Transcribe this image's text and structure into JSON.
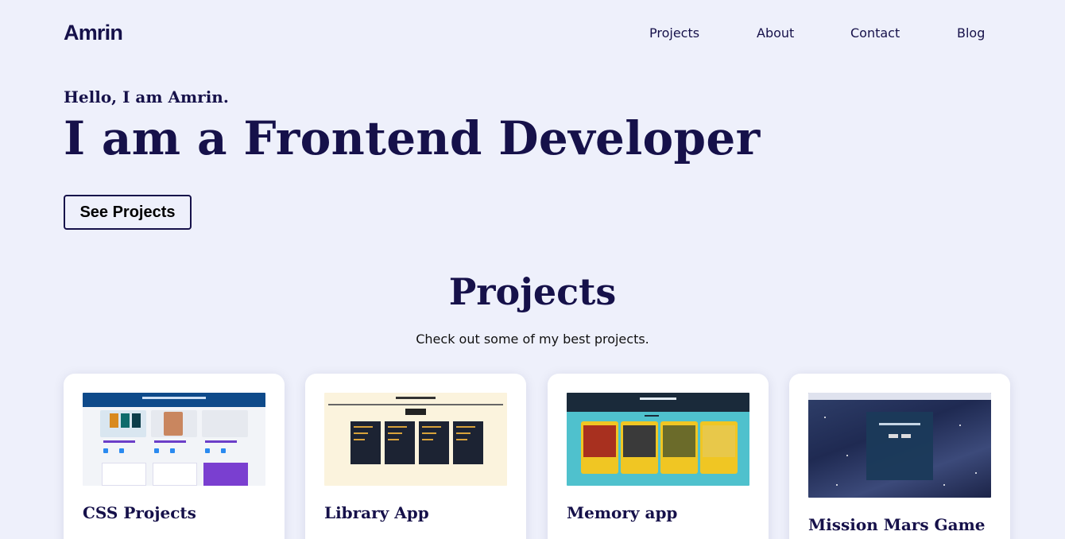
{
  "header": {
    "logo": "Amrin",
    "nav": [
      "Projects",
      "About",
      "Contact",
      "Blog"
    ]
  },
  "hero": {
    "greeting": "Hello, I am Amrin.",
    "headline": "I am a Frontend Developer",
    "cta": "See Projects"
  },
  "projects": {
    "title": "Projects",
    "subtitle": "Check out some of my best projects.",
    "cards": [
      {
        "title": "CSS Projects",
        "image": "css-projects-screenshot"
      },
      {
        "title": "Library App",
        "image": "library-app-screenshot"
      },
      {
        "title": "Memory app",
        "image": "memory-app-screenshot"
      },
      {
        "title": "Mission Mars Game",
        "image": "mission-mars-screenshot"
      }
    ]
  },
  "colors": {
    "background": "#eef0fb",
    "primary": "#16114a",
    "card": "#ffffff"
  }
}
